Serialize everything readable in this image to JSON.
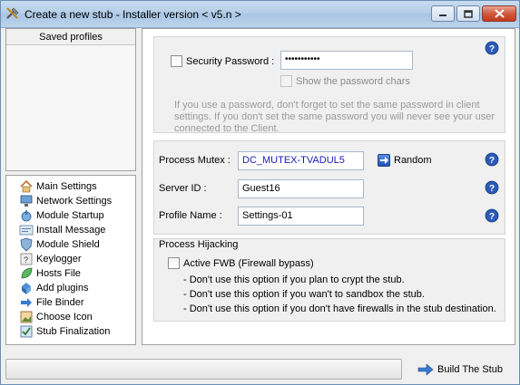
{
  "window": {
    "title": "Create a new stub - Installer version < v5.n >"
  },
  "saved_profiles": {
    "header": "Saved profiles"
  },
  "nav": {
    "items": [
      {
        "label": "Main Settings",
        "icon": "home-icon"
      },
      {
        "label": "Network Settings",
        "icon": "network-icon"
      },
      {
        "label": "Module Startup",
        "icon": "startup-icon"
      },
      {
        "label": "Install Message",
        "icon": "message-icon"
      },
      {
        "label": "Module Shield",
        "icon": "shield-icon"
      },
      {
        "label": "Keylogger",
        "icon": "keyboard-icon"
      },
      {
        "label": "Hosts File",
        "icon": "leaf-icon"
      },
      {
        "label": "Add plugins",
        "icon": "plugin-icon"
      },
      {
        "label": "File Binder",
        "icon": "binder-icon"
      },
      {
        "label": "Choose Icon",
        "icon": "image-icon"
      },
      {
        "label": "Stub Finalization",
        "icon": "finalize-icon"
      }
    ]
  },
  "security": {
    "password_label": "Security Password :",
    "password_value": "•••••••••••",
    "show_label": "Show the password chars",
    "hint": "If you use a password, don't forget to set the same password in client settings. If you don't set the same password you will never see your user connected to the Client."
  },
  "process": {
    "mutex_label": "Process Mutex :",
    "mutex_value": "DC_MUTEX-TVADUL5",
    "random_label": "Random",
    "server_id_label": "Server ID :",
    "server_id_value": "Guest16",
    "profile_label": "Profile Name :",
    "profile_value": "Settings-01"
  },
  "hijacking": {
    "title": "Process Hijacking",
    "checkbox_label": "Active FWB (Firewall bypass)",
    "notes": [
      "- Don't use this option if you plan to crypt the stub.",
      "- Don't use this option if you wan't to sandbox the stub.",
      "- Don't use this option if you don't have firewalls in the stub destination."
    ]
  },
  "footer": {
    "build_label": "Build The Stub"
  },
  "colors": {
    "accent": "#1a1ab8",
    "help": "#2a5bb8"
  }
}
